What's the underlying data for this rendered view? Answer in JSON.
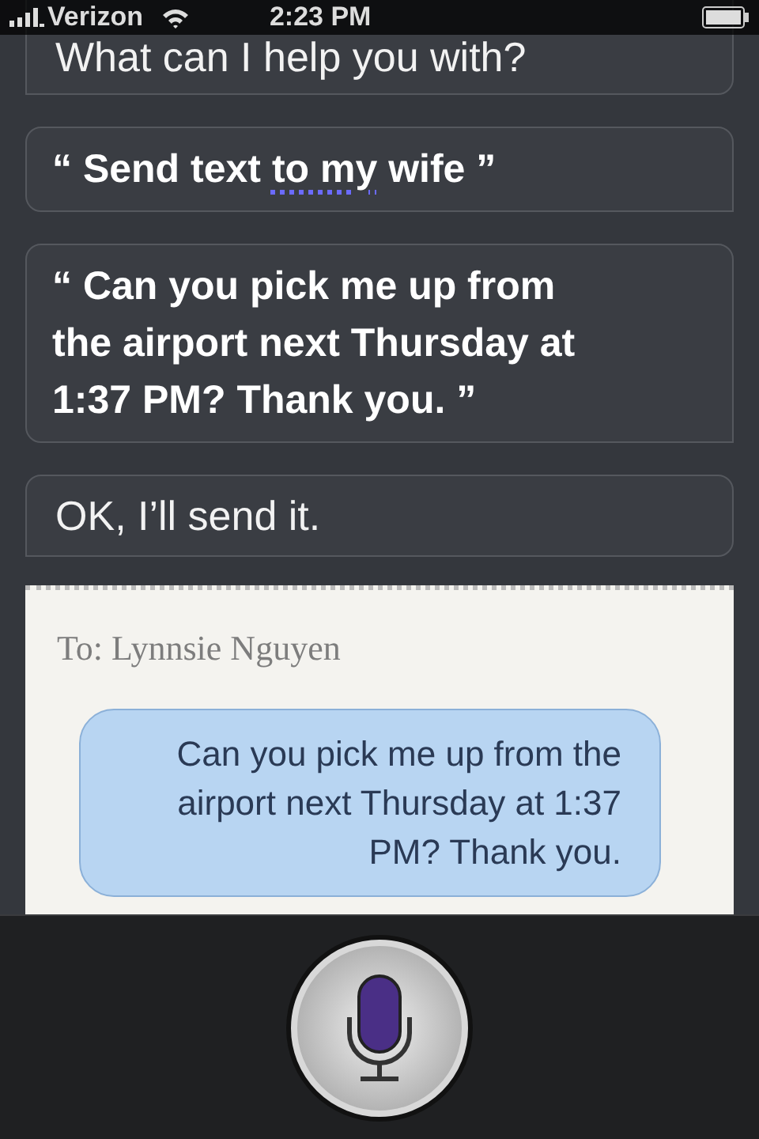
{
  "status_bar": {
    "carrier": "Verizon",
    "time": "2:23 PM"
  },
  "conversation": [
    {
      "kind": "siri",
      "text": "What can I help you with?"
    },
    {
      "kind": "user",
      "quote_open": "“",
      "quote_close": "”",
      "parts": [
        {
          "text": "Send text ",
          "flagged": false
        },
        {
          "text": "to my",
          "flagged": true
        },
        {
          "text": " wife",
          "flagged": false
        }
      ]
    },
    {
      "kind": "user",
      "quote_open": "“",
      "quote_close": "”",
      "parts": [
        {
          "text": "Can you pick me up from the airport next Thursday at 1:37 PM? Thank you.",
          "flagged": false
        }
      ]
    },
    {
      "kind": "siri",
      "text": "OK, I’ll send it."
    }
  ],
  "message_card": {
    "recipient": "To: Lynnsie Nguyen",
    "message": "Can you pick me up from the airport next Thursday at 1:37 PM? Thank you."
  }
}
